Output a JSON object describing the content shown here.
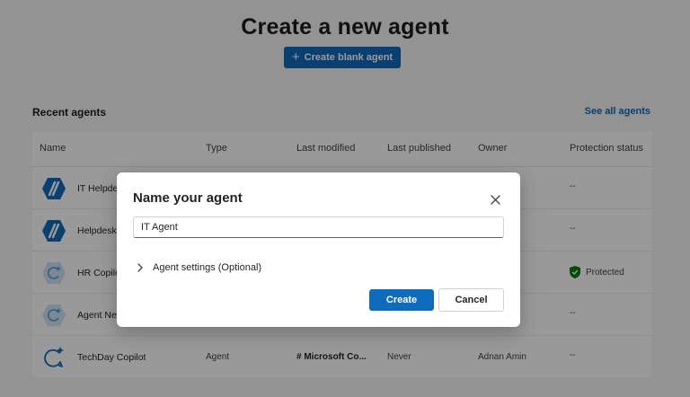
{
  "header": {
    "title": "Create a new agent",
    "create_blank_label": "Create blank agent"
  },
  "recent": {
    "section_title": "Recent agents",
    "see_all_label": "See all agents",
    "columns": [
      "Name",
      "Type",
      "Last modified",
      "Last published",
      "Owner",
      "Protection status"
    ],
    "rows": [
      {
        "icon": "blue-slash-hex-icon",
        "name": "IT Helpdesk",
        "type": "",
        "modified": "",
        "published": "",
        "owner": "n",
        "protection": "--",
        "protected": false
      },
      {
        "icon": "blue-slash-hex-icon",
        "name": "Helpdesk",
        "type": "",
        "modified": "",
        "published": "",
        "owner": "n",
        "protection": "--",
        "protected": false
      },
      {
        "icon": "copilot-hex-icon",
        "name": "HR Copilot",
        "type": "",
        "modified": "",
        "published": "",
        "owner": "n",
        "protection": "Protected",
        "protected": true
      },
      {
        "icon": "copilot-hex-icon",
        "name": "Agent New",
        "type": "",
        "modified": "",
        "published": "",
        "owner": "n",
        "protection": "--",
        "protected": false
      },
      {
        "icon": "copilot-outline-icon",
        "name": "TechDay Copilot",
        "type": "Agent",
        "modified": "# Microsoft Co...",
        "published": "Never",
        "owner": "Adnan Amin",
        "protection": "--",
        "protected": false
      }
    ]
  },
  "dialog": {
    "title": "Name your agent",
    "name_value": "IT Agent",
    "settings_label": "Agent settings (Optional)",
    "create_label": "Create",
    "cancel_label": "Cancel"
  },
  "colors": {
    "accent": "#0f6cbd",
    "protected_green": "#107c10",
    "overlay": "rgba(0,0,0,0.40)"
  }
}
